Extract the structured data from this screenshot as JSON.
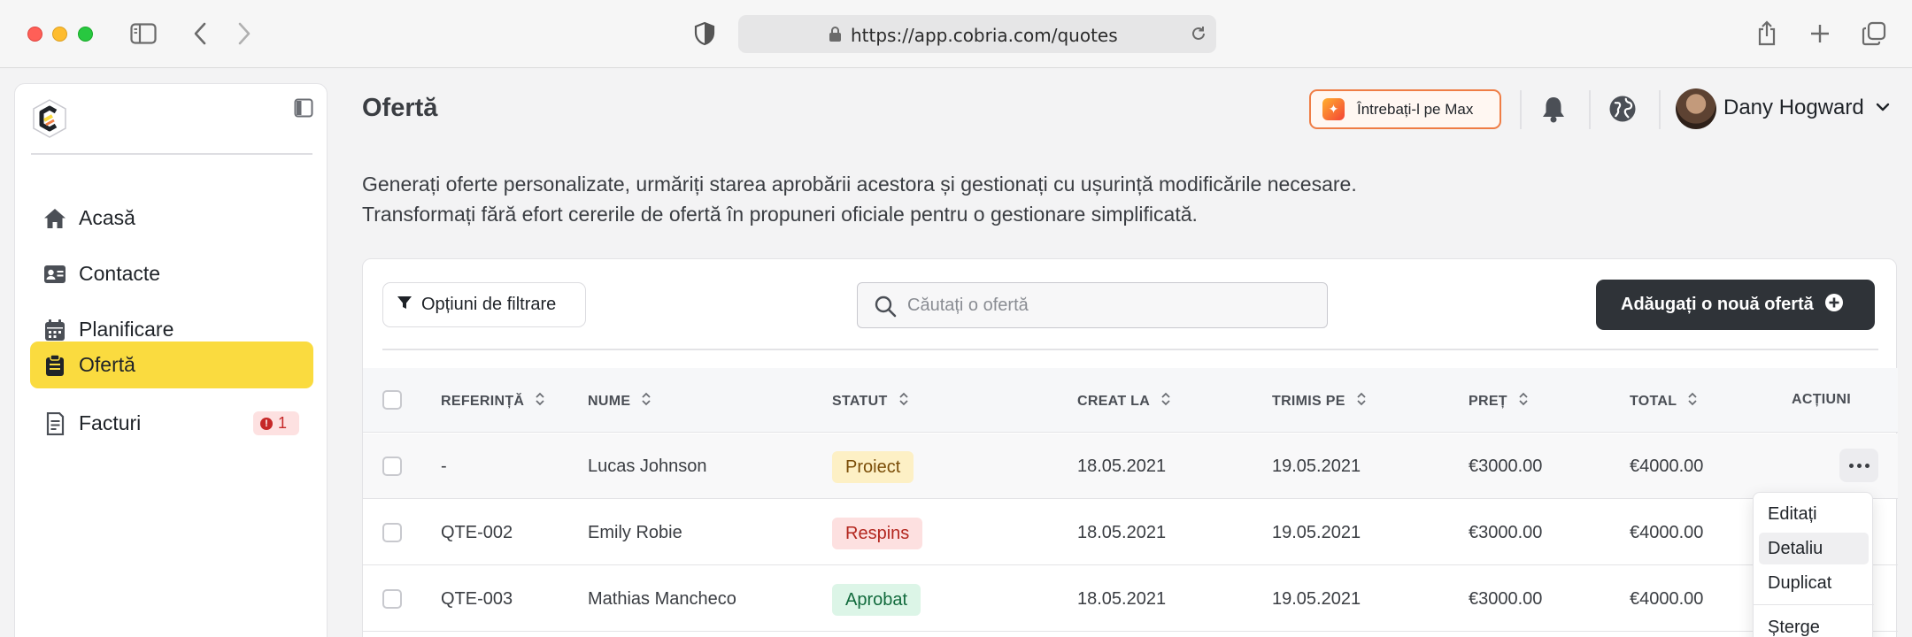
{
  "browser": {
    "url": "https://app.cobria.com/quotes"
  },
  "sidebar": {
    "items": [
      {
        "label": "Acasă",
        "icon": "home-icon",
        "active": false
      },
      {
        "label": "Contacte",
        "icon": "contact-card-icon",
        "active": false
      },
      {
        "label": "Planificare",
        "icon": "calendar-icon",
        "active": false
      },
      {
        "label": "Ofertă",
        "icon": "clipboard-icon",
        "active": true
      },
      {
        "label": "Facturi",
        "icon": "invoice-icon",
        "active": false,
        "badge": "1"
      }
    ],
    "active_color": "#fadb3f"
  },
  "header": {
    "title": "Ofertă",
    "ask_label": "Întrebați-l pe Max",
    "user_name": "Dany Hogward"
  },
  "description": {
    "line1": "Generați oferte personalizate, urmăriți starea aprobării acestora și gestionați cu ușurință modificările necesare.",
    "line2": "Transformați fără efort cererile de ofertă în propuneri oficiale pentru o gestionare simplificată."
  },
  "toolbar": {
    "filter_label": "Opțiuni de filtrare",
    "search_placeholder": "Căutați o ofertă",
    "add_label": "Adăugați o nouă ofertă"
  },
  "table": {
    "columns": [
      "REFERINȚĂ",
      "NUME",
      "STATUT",
      "CREAT LA",
      "TRIMIS PE",
      "PREȚ",
      "TOTAL",
      "ACȚIUNI"
    ],
    "rows": [
      {
        "ref": "-",
        "name": "Lucas Johnson",
        "status": "Proiect",
        "status_kind": "draft",
        "created": "18.05.2021",
        "sent": "19.05.2021",
        "price": "€3000.00",
        "total": "€4000.00"
      },
      {
        "ref": "QTE-002",
        "name": "Emily Robie",
        "status": "Respins",
        "status_kind": "rejected",
        "created": "18.05.2021",
        "sent": "19.05.2021",
        "price": "€3000.00",
        "total": "€4000.00"
      },
      {
        "ref": "QTE-003",
        "name": "Mathias Mancheco",
        "status": "Aprobat",
        "status_kind": "approved",
        "created": "18.05.2021",
        "sent": "19.05.2021",
        "price": "€3000.00",
        "total": "€4000.00"
      }
    ]
  },
  "action_menu": {
    "items": [
      "Editați",
      "Detaliu",
      "Duplicat",
      "Șterge"
    ],
    "highlighted": "Detaliu"
  },
  "colors": {
    "primary_dark": "#2f3338",
    "accent_orange": "#ef7d45",
    "draft_bg": "#fdf0c5",
    "rejected_bg": "#fde0e0",
    "approved_bg": "#dcf5e7"
  }
}
